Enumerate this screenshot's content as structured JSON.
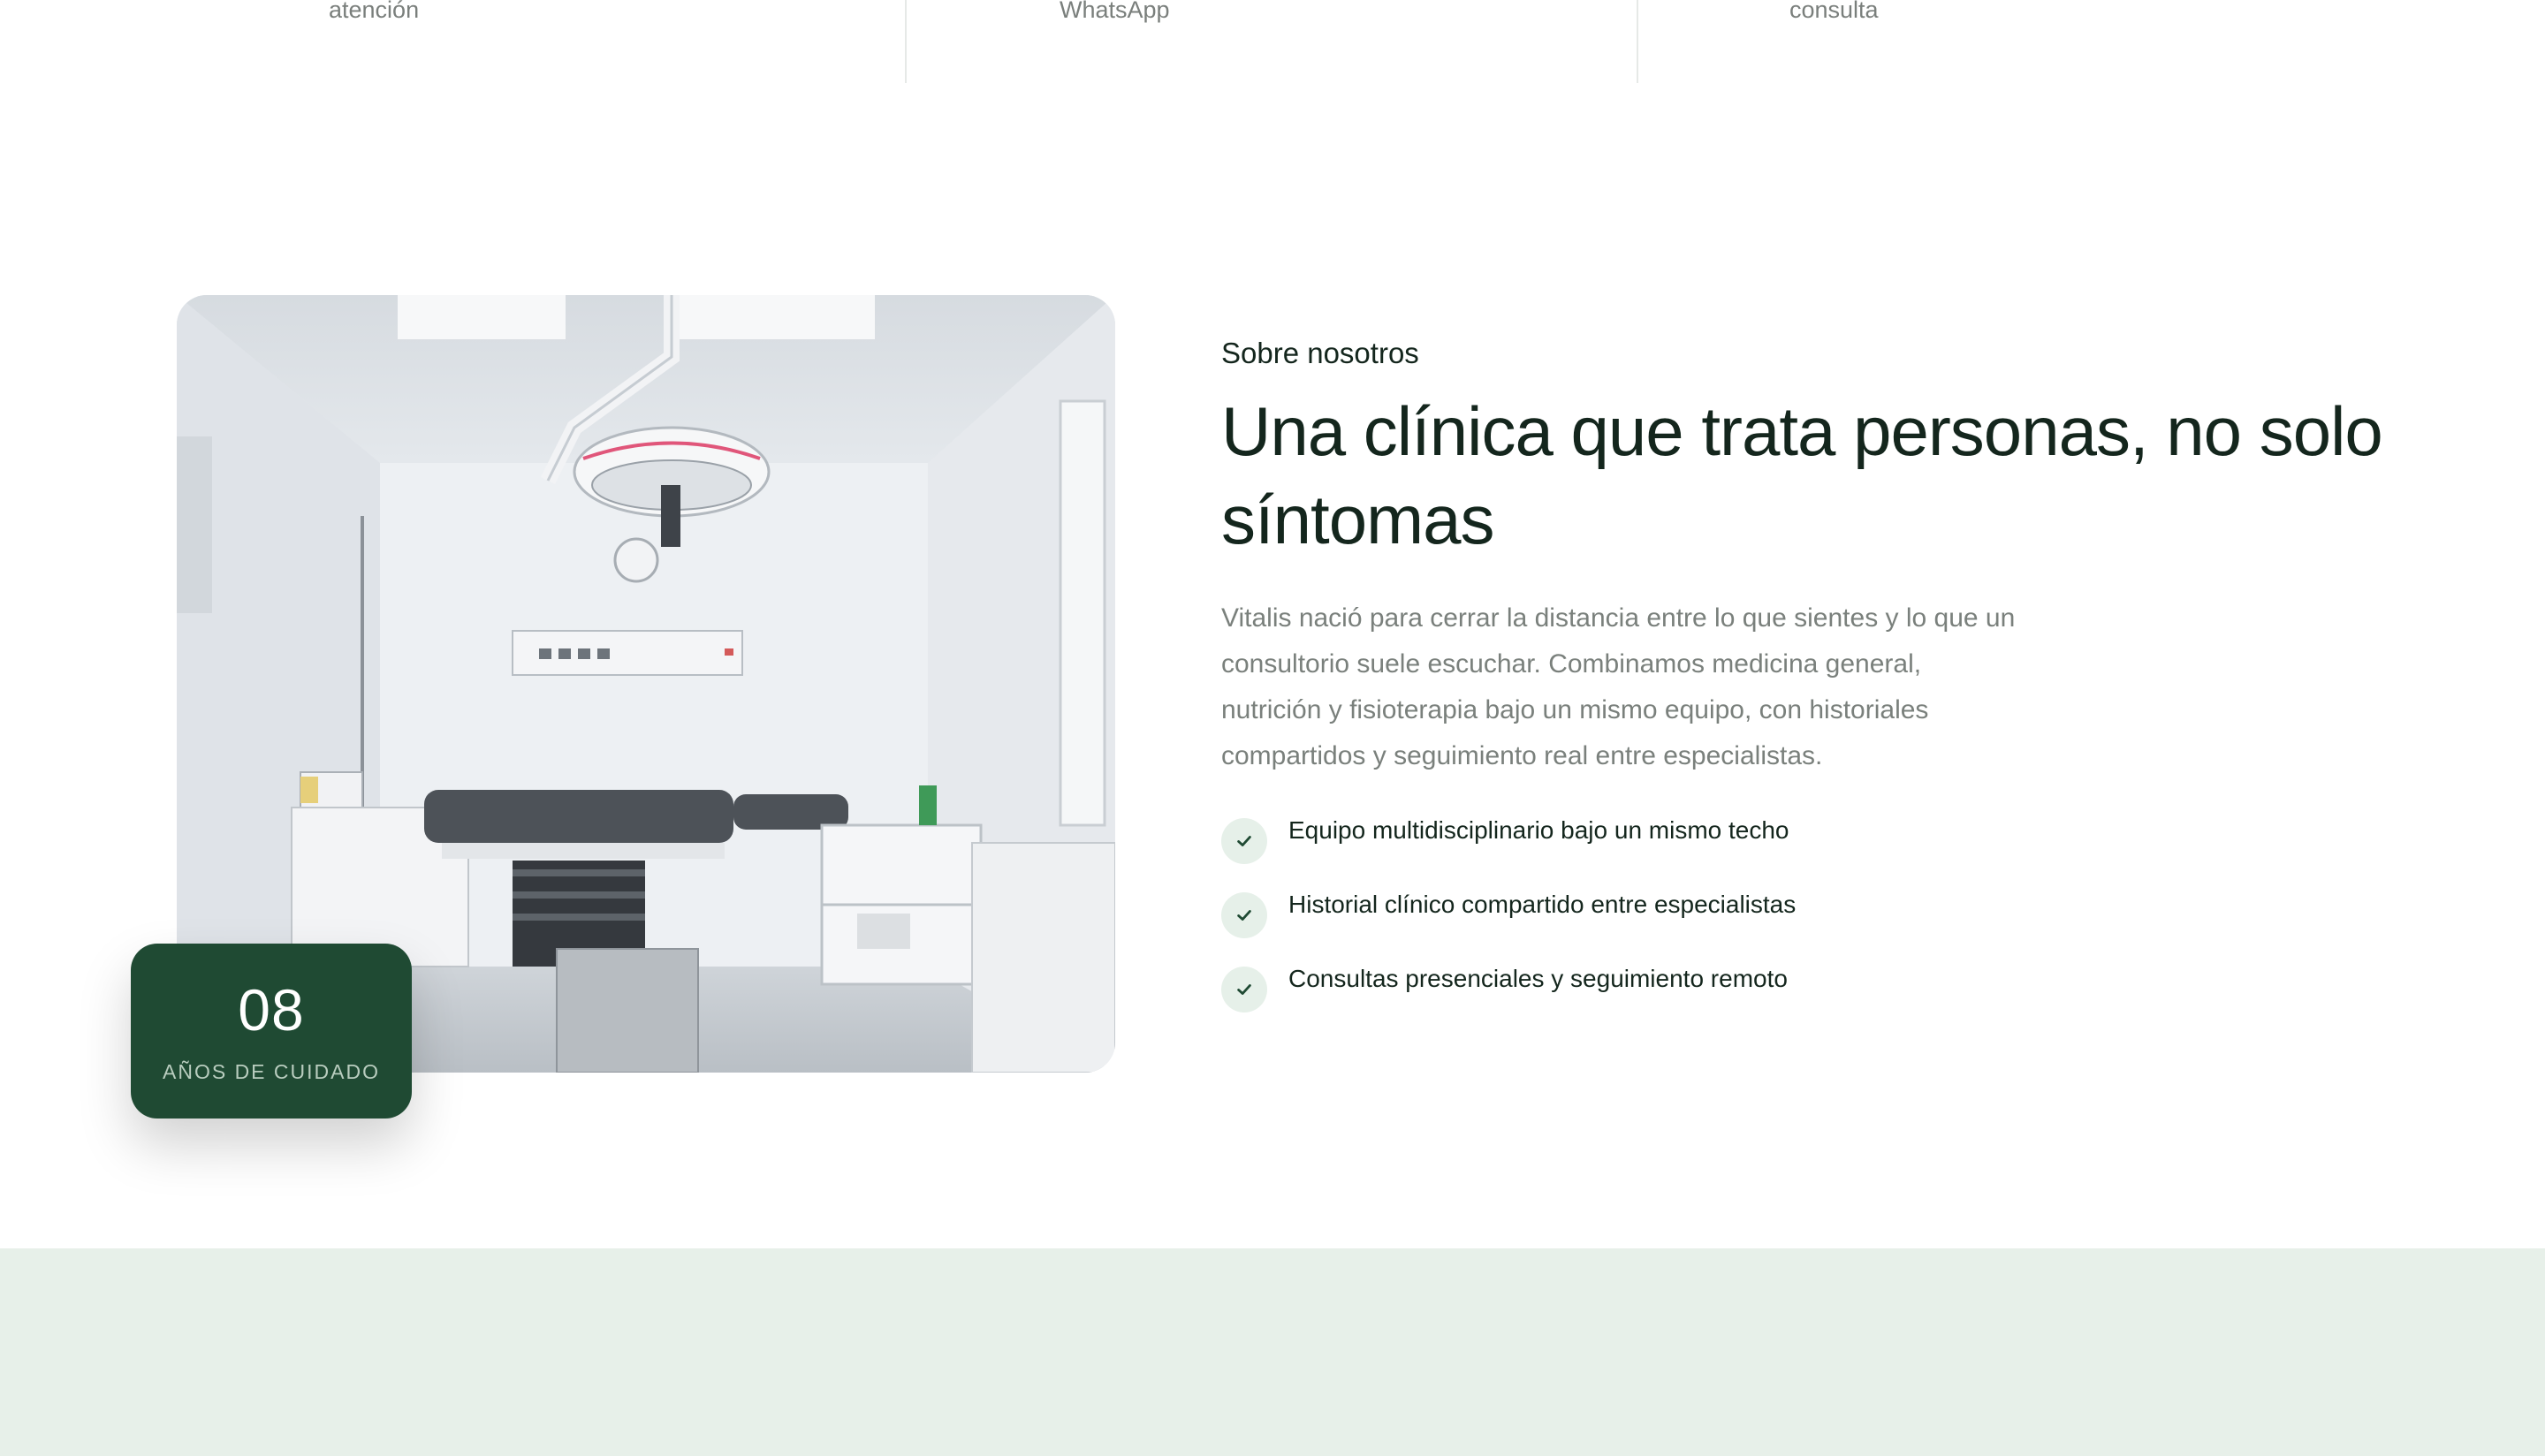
{
  "stats": [
    {
      "label": "atención"
    },
    {
      "label": "WhatsApp"
    },
    {
      "label": "consulta"
    }
  ],
  "about": {
    "eyebrow": "Sobre nosotros",
    "title": "Una clínica que trata personas, no solo síntomas",
    "description": "Vitalis nació para cerrar la distancia entre lo que sientes y lo que un consultorio suele escuchar. Combinamos medicina general, nutrición y fisioterapia bajo un mismo equipo, con historiales compartidos y seguimiento real entre especialistas.",
    "features": [
      {
        "text": "Equipo multidisciplinario bajo un mismo techo",
        "icon": "check-icon"
      },
      {
        "text": "Historial clínico compartido entre especialistas",
        "icon": "check-icon"
      },
      {
        "text": "Consultas presenciales y seguimiento remoto",
        "icon": "check-icon"
      }
    ],
    "badge": {
      "value": "08",
      "label": "AÑOS DE CUIDADO"
    }
  },
  "colors": {
    "brand_green": "#1f4a33",
    "mint_background": "#e7f0e9",
    "check_background": "#e6f0e9",
    "text_dark": "#14261d",
    "text_muted": "#7a807c"
  }
}
